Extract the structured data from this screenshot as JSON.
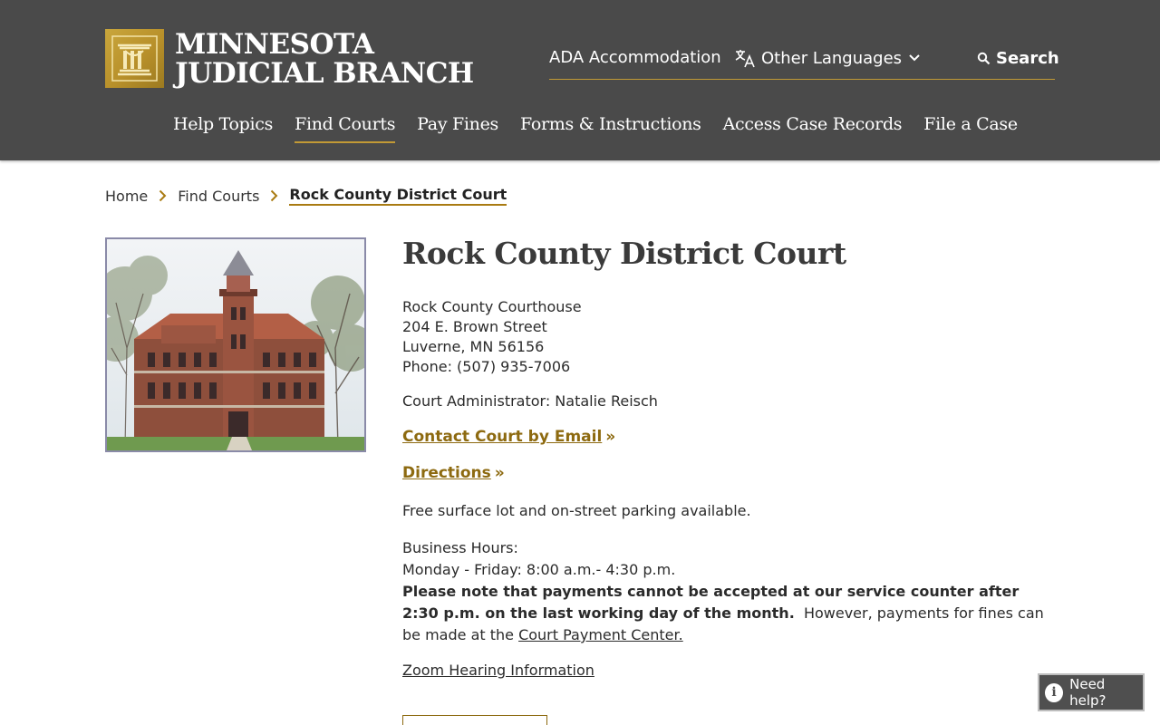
{
  "header": {
    "logo_line1": "MINNESOTA",
    "logo_line2": "JUDICIAL BRANCH",
    "utility": {
      "ada": "ADA Accommodation",
      "languages": "Other Languages",
      "search": "Search"
    },
    "nav": [
      {
        "label": "Help Topics"
      },
      {
        "label": "Find Courts"
      },
      {
        "label": "Pay Fines"
      },
      {
        "label": "Forms & Instructions"
      },
      {
        "label": "Access Case Records"
      },
      {
        "label": "File a Case"
      }
    ],
    "active_nav": "Find Courts",
    "colors": {
      "header_bg": "#4a4a4a",
      "accent_gold": "#c29a35",
      "link_gold": "#8d6a10"
    }
  },
  "breadcrumb": {
    "items": [
      "Home",
      "Find Courts",
      "Rock County District Court"
    ]
  },
  "court": {
    "title": "Rock County District Court",
    "address_lines": [
      "Rock County Courthouse",
      "204 E. Brown Street",
      "Luverne, MN 56156",
      "Phone: (507) 935-7006"
    ],
    "administrator": "Court Administrator: Natalie Reisch",
    "contact_link": "Contact Court by Email",
    "directions_link": "Directions",
    "link_arrow": "»",
    "parking": "Free surface lot and on-street parking available.",
    "hours_label": "Business Hours:",
    "hours_value": "Monday - Friday: 8:00 a.m.- 4:30 p.m.",
    "payment_note_bold": "Please note that payments cannot be accepted at our service counter after 2:30 p.m. on the last working day of the month.",
    "payment_note_plain": "  However, payments for fines can be made at the ",
    "payment_center_link": "Court Payment Center.",
    "zoom_link": "Zoom Hearing Information"
  },
  "help": {
    "label": "Need help?",
    "icon": "info-icon"
  }
}
